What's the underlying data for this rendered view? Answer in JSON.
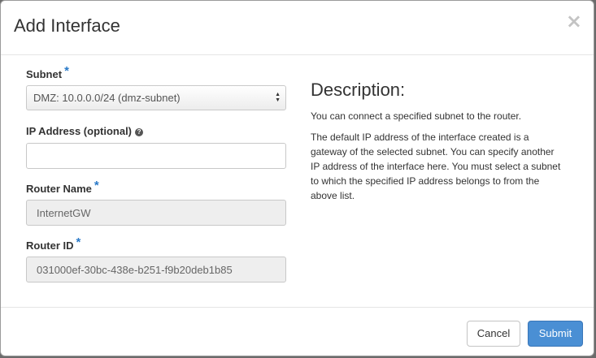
{
  "modal": {
    "title": "Add Interface",
    "close_glyph": "×"
  },
  "form": {
    "subnet": {
      "label": "Subnet",
      "required_mark": "*",
      "selected": "DMZ: 10.0.0.0/24 (dmz-subnet)"
    },
    "ip_address": {
      "label": "IP Address (optional)",
      "help_glyph": "?",
      "value": ""
    },
    "router_name": {
      "label": "Router Name",
      "required_mark": "*",
      "value": "InternetGW"
    },
    "router_id": {
      "label": "Router ID",
      "required_mark": "*",
      "value": "031000ef-30bc-438e-b251-f9b20deb1b85"
    }
  },
  "description": {
    "title": "Description:",
    "paragraphs": [
      "You can connect a specified subnet to the router.",
      "The default IP address of the interface created is a gateway of the selected subnet. You can specify another IP address of the interface here. You must select a subnet to which the specified IP address belongs to from the above list."
    ]
  },
  "footer": {
    "cancel_label": "Cancel",
    "submit_label": "Submit"
  },
  "colors": {
    "required": "#2a7ac8",
    "primary_button": "#4a8fd4"
  }
}
